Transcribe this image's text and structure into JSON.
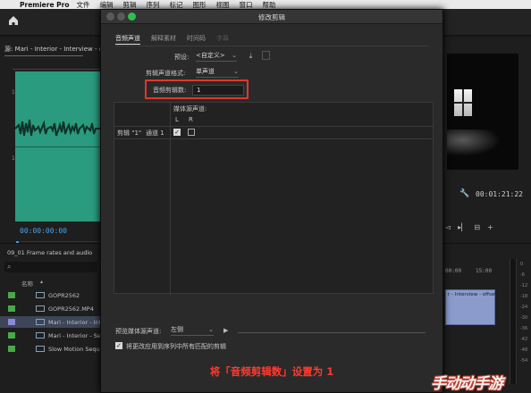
{
  "menubar": {
    "app_name": "Premiere Pro",
    "items": [
      "文件",
      "编辑",
      "剪辑",
      "序列",
      "标记",
      "图形",
      "视图",
      "窗口",
      "帮助"
    ]
  },
  "source_panel": {
    "tab_label": "源: Mari - Interior - Interview - offse",
    "timecode": "00:00:00:00",
    "scale_top": "1",
    "scale_bottom": "1"
  },
  "project_panel": {
    "title": "09_01 Frame rates and audio",
    "column_name": "名称",
    "items": [
      {
        "name": "GOPR2562",
        "color": "#4aa84a",
        "selected": false
      },
      {
        "name": "GOPR2562.MP4",
        "color": "#4aa84a",
        "selected": false
      },
      {
        "name": "Mari - Interior - Interv",
        "color": "#8a8ad8",
        "selected": true
      },
      {
        "name": "Mari - Interior - Sec",
        "color": "#4aa84a",
        "selected": false
      },
      {
        "name": "Slow Motion Seque",
        "color": "#4aa84a",
        "selected": false
      }
    ]
  },
  "program_panel": {
    "timecode": "00:01:21:22",
    "timeline_times": [
      "00:00",
      "15:00"
    ],
    "clip_label": "r - Interview - offset",
    "meter_labels": [
      "0",
      "-6",
      "-12",
      "-18",
      "-24",
      "-30",
      "-36",
      "-42",
      "-48",
      "-54"
    ]
  },
  "dialog": {
    "title": "修改剪辑",
    "tabs": [
      {
        "label": "音频声道",
        "state": "active"
      },
      {
        "label": "解释素材",
        "state": "normal"
      },
      {
        "label": "时间码",
        "state": "normal"
      },
      {
        "label": "字幕",
        "state": "disabled"
      }
    ],
    "preset_label": "预设:",
    "preset_value": "<自定义>",
    "clip_channel_format_label": "剪辑声道格式:",
    "clip_channel_format_value": "单声道",
    "audio_clip_count_label": "音频剪辑数:",
    "audio_clip_count_value": "1",
    "media_source_channel_label": "媒体源声道:",
    "channel_L": "L",
    "channel_R": "R",
    "row_clip_label": "剪辑 \"1\"",
    "row_channel_label": "通道 1",
    "L_checked": true,
    "R_checked": false,
    "preview_label": "预览媒体源声道:",
    "preview_value": "左侧",
    "apply_all_label": "将更改应用到序列中所有匹配的剪辑",
    "apply_all_checked": true,
    "caption": "将「音频剪辑数」设置为 1"
  },
  "watermark": "手动动手游"
}
